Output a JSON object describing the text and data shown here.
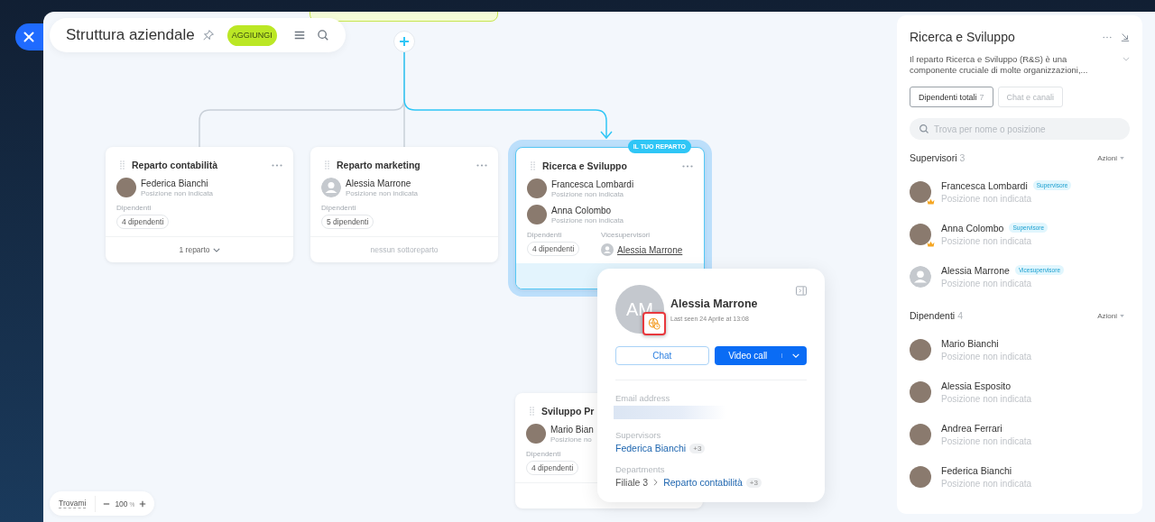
{
  "header": {
    "title": "Struttura aziendale",
    "add_button": "AGGIUNGI"
  },
  "departments": [
    {
      "title": "Reparto contabilità",
      "selected": false,
      "heads": [
        {
          "name": "Federica Bianchi",
          "position": "Posizione non indicata",
          "has_photo": true
        }
      ],
      "employees_label": "Dipendenti",
      "employees": "4 dipendenti",
      "footer": {
        "text": "1 reparto",
        "expandable": true
      }
    },
    {
      "title": "Reparto marketing",
      "selected": false,
      "heads": [
        {
          "name": "Alessia Marrone",
          "position": "Posizione non indicata",
          "has_photo": false
        }
      ],
      "employees_label": "Dipendenti",
      "employees": "5 dipendenti",
      "footer": {
        "text": "nessun sottoreparto",
        "expandable": false
      }
    },
    {
      "title": "Ricerca e Sviluppo",
      "selected": true,
      "badge": "IL TUO REPARTO",
      "heads": [
        {
          "name": "Francesca Lombardi",
          "position": "Posizione non indicata",
          "has_photo": true
        },
        {
          "name": "Anna Colombo",
          "position": "Posizione non indicata",
          "has_photo": true
        }
      ],
      "employees_label": "Dipendenti",
      "employees": "4 dipendenti",
      "deputies_label": "Vicesupervisori",
      "deputies": [
        {
          "name": "Alessia Marrone",
          "has_photo": false
        }
      ]
    },
    {
      "title": "Sviluppo Pr",
      "selected": false,
      "heads": [
        {
          "name": "Mario Bian",
          "position": "Posizione no",
          "has_photo": true
        }
      ],
      "employees_label": "Dipendenti",
      "employees": "4 dipendenti"
    }
  ],
  "profile_card": {
    "initials": "AM",
    "name": "Alessia Marrone",
    "last_seen": "Last seen 24 Aprile at 13:08",
    "timezone_highlighted": true,
    "chat_button": "Chat",
    "call_button": "Video call",
    "email_label": "Email address",
    "supervisors_label": "Supervisors",
    "supervisor": "Federica Bianchi",
    "supervisors_more": "+3",
    "departments_label": "Departments",
    "branch": "Filiale 3",
    "department": "Reparto contabilità",
    "departments_more": "+3"
  },
  "side_panel": {
    "title": "Ricerca e Sviluppo",
    "description": "Il reparto Ricerca e Sviluppo (R&S) è una componente cruciale di molte organizzazioni,...",
    "tabs": [
      {
        "label": "Dipendenti totali",
        "count": "7",
        "selected": true
      },
      {
        "label": "Chat e canali",
        "selected": false
      }
    ],
    "search": {
      "placeholder": "Trova per nome o posizione"
    },
    "sections": [
      {
        "title": "Supervisori",
        "count": "3",
        "action": "Azioni",
        "people": [
          {
            "name": "Francesca Lombardi",
            "position": "Posizione non indicata",
            "has_photo": true,
            "crown": true,
            "role": "Supervisore"
          },
          {
            "name": "Anna Colombo",
            "position": "Posizione non indicata",
            "has_photo": true,
            "crown": true,
            "role": "Supervisore"
          },
          {
            "name": "Alessia Marrone",
            "position": "Posizione non indicata",
            "has_photo": false,
            "crown": false,
            "role": "Vicesupervisore"
          }
        ]
      },
      {
        "title": "Dipendenti",
        "count": "4",
        "action": "Azioni",
        "people": [
          {
            "name": "Mario Bianchi",
            "position": "Posizione non indicata",
            "has_photo": true,
            "crown": false
          },
          {
            "name": "Alessia Esposito",
            "position": "Posizione non indicata",
            "has_photo": true,
            "crown": false
          },
          {
            "name": "Andrea Ferrari",
            "position": "Posizione non indicata",
            "has_photo": true,
            "crown": false
          },
          {
            "name": "Federica Bianchi",
            "position": "Posizione non indicata",
            "has_photo": true,
            "crown": false
          }
        ]
      }
    ]
  },
  "zoom": {
    "find_me": "Trovami",
    "value": "100",
    "unit": "%"
  }
}
